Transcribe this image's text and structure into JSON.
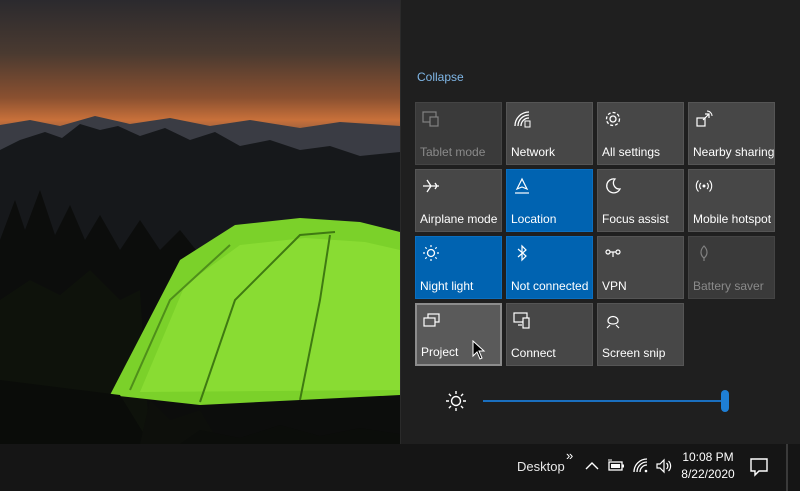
{
  "action_center": {
    "collapse_label": "Collapse",
    "tiles": [
      {
        "label": "Tablet mode",
        "icon": "tablet-mode-icon",
        "state": "disabled"
      },
      {
        "label": "Network",
        "icon": "network-icon",
        "state": "off"
      },
      {
        "label": "All settings",
        "icon": "gear-icon",
        "state": "off"
      },
      {
        "label": "Nearby sharing",
        "icon": "nearby-sharing-icon",
        "state": "off"
      },
      {
        "label": "Airplane mode",
        "icon": "airplane-icon",
        "state": "off"
      },
      {
        "label": "Location",
        "icon": "location-icon",
        "state": "on"
      },
      {
        "label": "Focus assist",
        "icon": "moon-icon",
        "state": "off"
      },
      {
        "label": "Mobile hotspot",
        "icon": "hotspot-icon",
        "state": "off"
      },
      {
        "label": "Night light",
        "icon": "night-light-icon",
        "state": "on"
      },
      {
        "label": "Not connected",
        "icon": "bluetooth-icon",
        "state": "on"
      },
      {
        "label": "VPN",
        "icon": "vpn-icon",
        "state": "off"
      },
      {
        "label": "Battery saver",
        "icon": "battery-saver-icon",
        "state": "disabled"
      },
      {
        "label": "Project",
        "icon": "project-icon",
        "state": "hover"
      },
      {
        "label": "Connect",
        "icon": "connect-icon",
        "state": "off"
      },
      {
        "label": "Screen snip",
        "icon": "screen-snip-icon",
        "state": "off"
      }
    ],
    "brightness": {
      "icon": "brightness-icon",
      "value": 1.0
    }
  },
  "taskbar": {
    "desktop_label": "Desktop",
    "overflow_glyph": "»",
    "time": "10:08 PM",
    "date": "8/22/2020",
    "tray_icons": [
      "chevron-up-icon",
      "battery-icon",
      "wifi-icon",
      "volume-icon"
    ],
    "notification_icon": "notification-center-icon"
  },
  "colors": {
    "accent": "#0063b1",
    "tile_off": "#474747",
    "panel_bg": "#1f1f1f",
    "link": "#7fb6e6"
  }
}
